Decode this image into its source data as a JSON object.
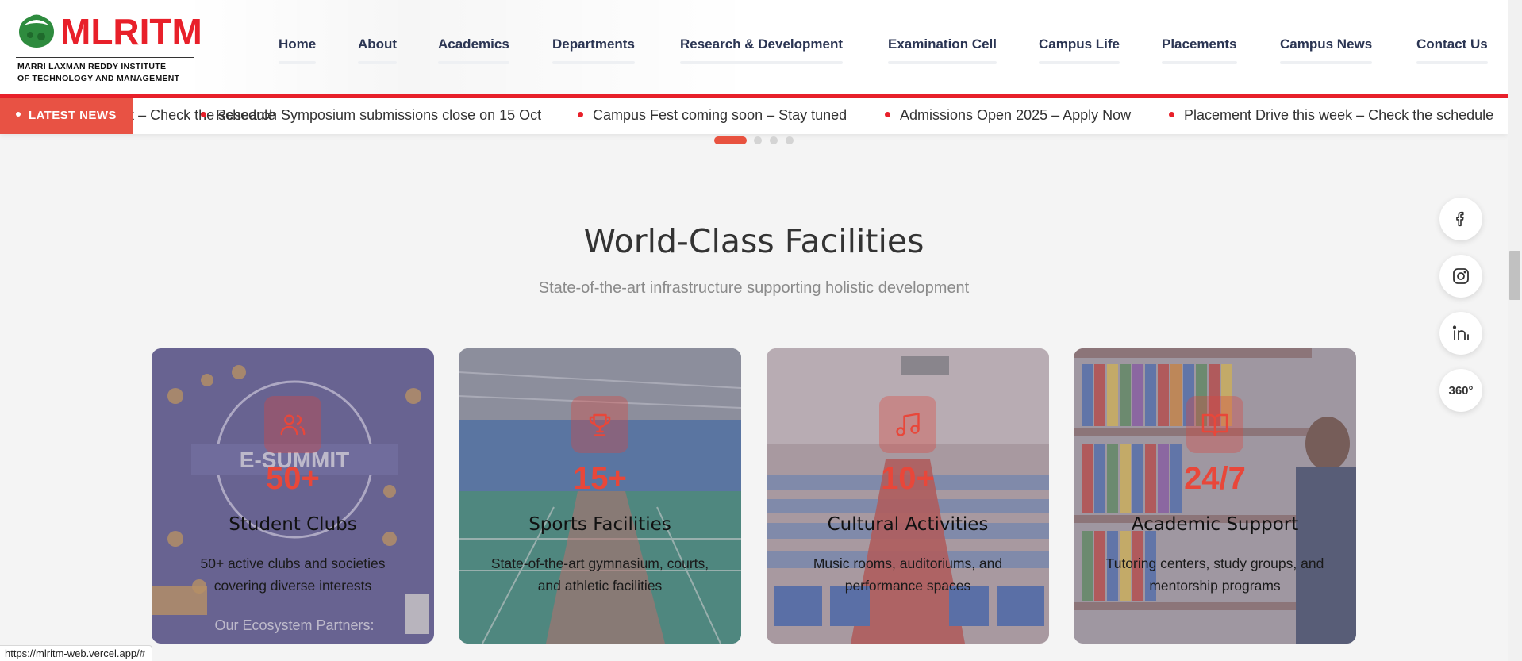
{
  "brand": {
    "name": "MLRITM",
    "subtitle_line1": "MARRI LAXMAN REDDY INSTITUTE",
    "subtitle_line2": "OF TECHNOLOGY AND MANAGEMENT",
    "primary_color": "#e8202a"
  },
  "nav": {
    "items": [
      {
        "label": "Home"
      },
      {
        "label": "About"
      },
      {
        "label": "Academics"
      },
      {
        "label": "Departments"
      },
      {
        "label": "Research & Development"
      },
      {
        "label": "Examination Cell"
      },
      {
        "label": "Campus Life"
      },
      {
        "label": "Placements"
      },
      {
        "label": "Campus News"
      },
      {
        "label": "Contact Us"
      }
    ]
  },
  "news": {
    "badge": "LATEST NEWS",
    "items": [
      "Placement Drive this week – Check the schedule",
      "Research Symposium submissions close on 15 Oct",
      "Campus Fest coming soon – Stay tuned",
      "Admissions Open 2025 – Apply Now",
      "Placement Drive this week – Check the schedule"
    ]
  },
  "carousel": {
    "total_slides": 4,
    "active_slide": 1
  },
  "facilities": {
    "title": "World-Class Facilities",
    "subtitle": "State-of-the-art infrastructure supporting holistic development",
    "cards": [
      {
        "stat": "50+",
        "title": "Student Clubs",
        "description": "50+ active clubs and societies covering diverse interests",
        "icon": "users-icon"
      },
      {
        "stat": "15+",
        "title": "Sports Facilities",
        "description": "State-of-the-art gymnasium, courts, and athletic facilities",
        "icon": "trophy-icon"
      },
      {
        "stat": "10+",
        "title": "Cultural Activities",
        "description": "Music rooms, auditoriums, and performance spaces",
        "icon": "music-icon"
      },
      {
        "stat": "24/7",
        "title": "Academic Support",
        "description": "Tutoring centers, study groups, and mentorship programs",
        "icon": "book-open-icon"
      }
    ]
  },
  "social": {
    "items": [
      {
        "icon": "facebook-icon"
      },
      {
        "icon": "instagram-icon"
      },
      {
        "icon": "linkedin-icon"
      },
      {
        "icon": "360-tour-icon",
        "label": "360°"
      }
    ]
  },
  "status_bar": {
    "url": "https://mlritm-web.vercel.app/#"
  }
}
